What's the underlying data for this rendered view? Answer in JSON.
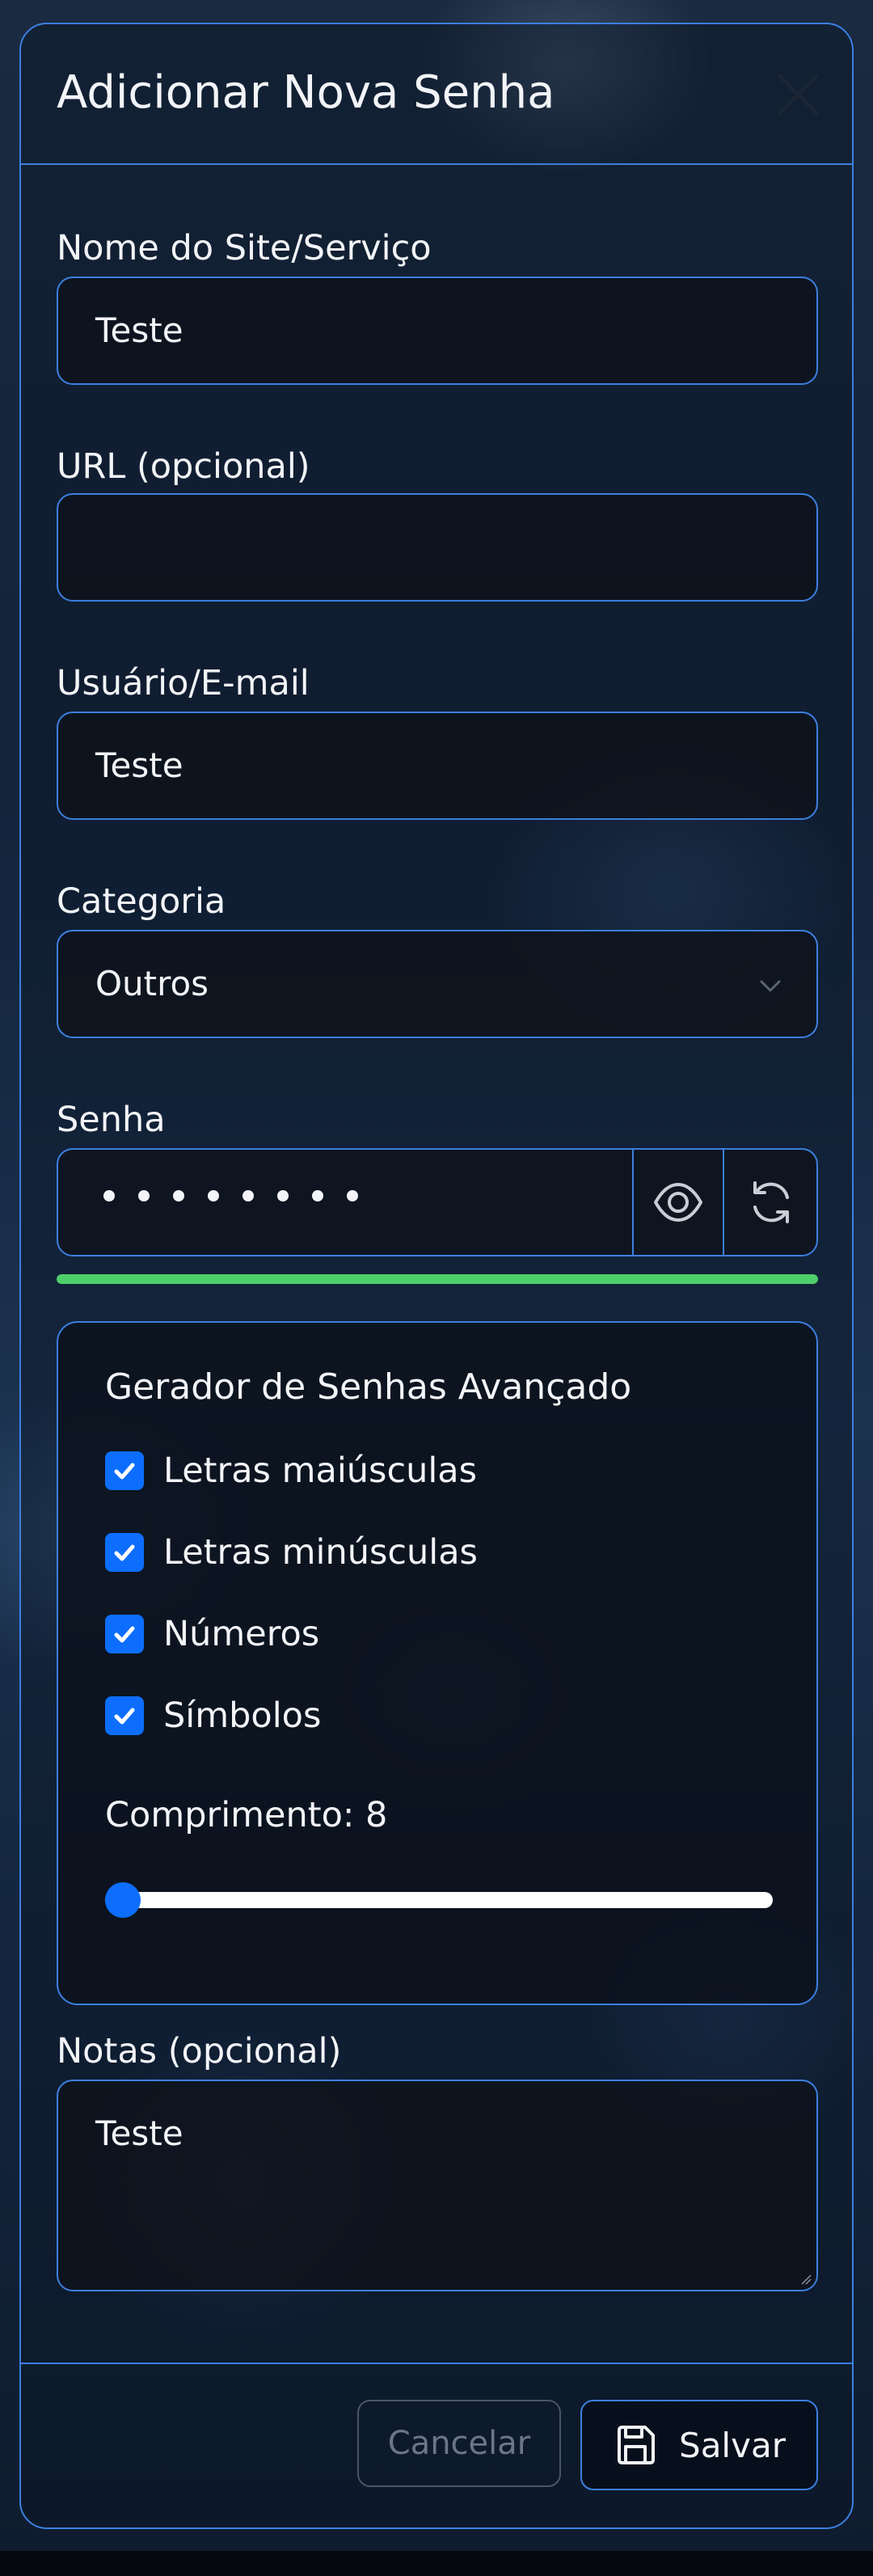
{
  "modal": {
    "title": "Adicionar Nova Senha",
    "close_icon": "close-icon"
  },
  "fields": {
    "site": {
      "label": "Nome do Site/Serviço",
      "value": "Teste"
    },
    "url": {
      "label": "URL (opcional)",
      "value": ""
    },
    "username": {
      "label": "Usuário/E-mail",
      "value": "Teste"
    },
    "category": {
      "label": "Categoria",
      "value": "Outros",
      "icon": "chevron-down-icon"
    },
    "password": {
      "label": "Senha",
      "masked_length": 8,
      "toggle_icon": "eye-icon",
      "generate_icon": "refresh-icon",
      "strength_fraction": 1.0,
      "strength_color": "#4fcf6a"
    },
    "notes": {
      "label": "Notas (opcional)",
      "value": "Teste"
    }
  },
  "generator": {
    "title": "Gerador de Senhas Avançado",
    "options": [
      {
        "label": "Letras maiúsculas",
        "checked": true
      },
      {
        "label": "Letras minúsculas",
        "checked": true
      },
      {
        "label": "Números",
        "checked": true
      },
      {
        "label": "Símbolos",
        "checked": true
      }
    ],
    "length_label": "Comprimento: 8",
    "length_value": 8,
    "length_fraction": 0.0
  },
  "footer": {
    "cancel_label": "Cancelar",
    "save_label": "Salvar",
    "save_icon": "save-icon"
  },
  "colors": {
    "accent": "#3c7fe0",
    "primary": "#0d6efd",
    "strength": "#4fcf6a"
  }
}
